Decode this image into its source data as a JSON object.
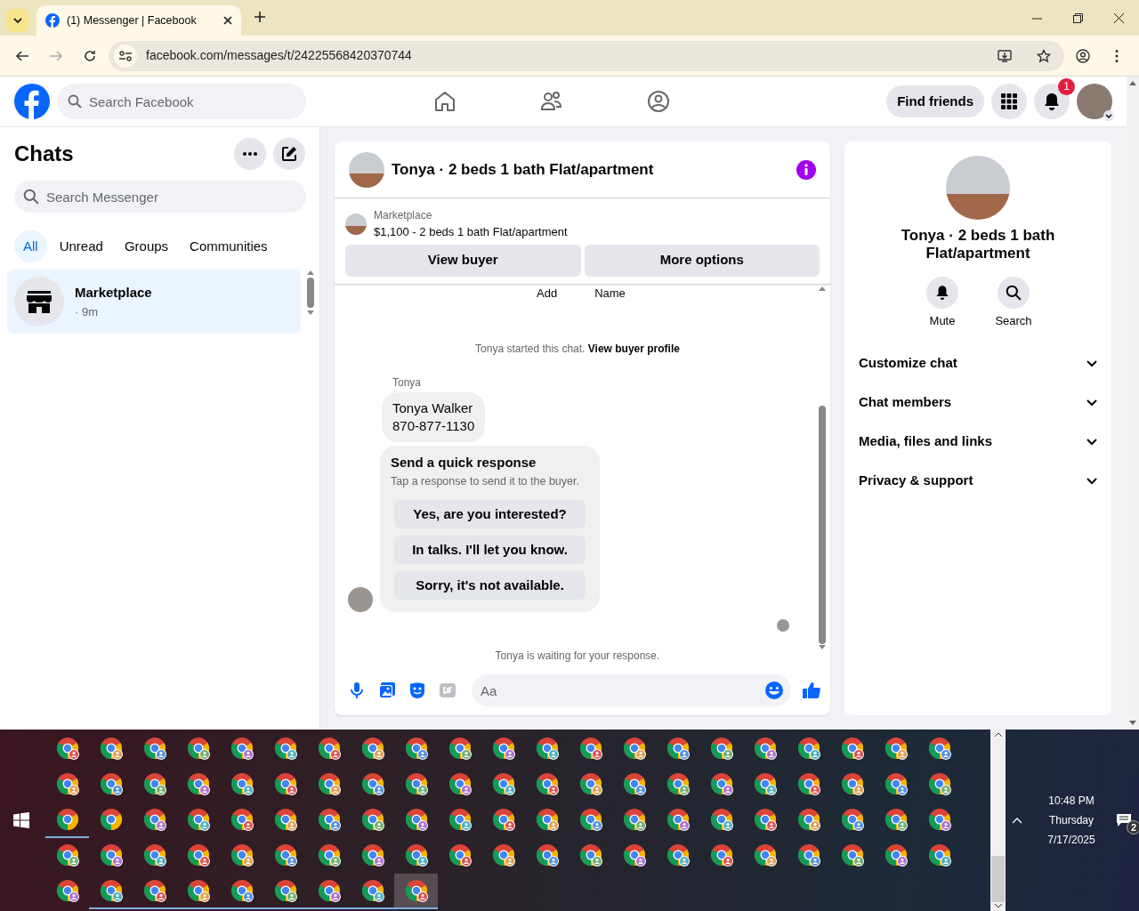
{
  "browser": {
    "tab_title": "(1) Messenger | Facebook",
    "url": "facebook.com/messages/t/24225568420370744"
  },
  "topbar": {
    "search_placeholder": "Search Facebook",
    "find_friends": "Find friends",
    "notification_count": "1"
  },
  "sidebar": {
    "title": "Chats",
    "search_placeholder": "Search Messenger",
    "filters": [
      {
        "label": "All",
        "selected": true
      },
      {
        "label": "Unread",
        "selected": false
      },
      {
        "label": "Groups",
        "selected": false
      },
      {
        "label": "Communities",
        "selected": false
      }
    ],
    "chats": [
      {
        "name": "Marketplace",
        "time": "· 9m",
        "selected": true
      }
    ]
  },
  "chat": {
    "title": "Tonya · 2 beds 1 bath Flat/apartment",
    "listing_source": "Marketplace",
    "listing_summary": "$1,100 - 2 beds 1 bath Flat/apartment",
    "buttons": [
      "View buyer",
      "More options"
    ],
    "cut_off_labels": [
      "Add",
      "Name"
    ],
    "system_note": "Tonya started this chat.",
    "system_link": "View buyer profile",
    "sender": "Tonya",
    "message_lines": [
      "Tonya Walker",
      "870-877-1130"
    ],
    "quick_response": {
      "title": "Send a quick response",
      "subtitle": "Tap a response to send it to the buyer.",
      "options": [
        "Yes, are you interested?",
        "In talks. I'll let you know.",
        "Sorry, it's not available."
      ]
    },
    "waiting_note": "Tonya is waiting for your response.",
    "composer_placeholder": "Aa"
  },
  "details": {
    "title": "Tonya · 2 beds 1 bath Flat/apartment",
    "actions": [
      "Mute",
      "Search"
    ],
    "sections": [
      "Customize chat",
      "Chat members",
      "Media, files and links",
      "Privacy & support"
    ]
  },
  "taskbar": {
    "time": "10:48 PM",
    "day": "Thursday",
    "date": "7/17/2025",
    "notification_count": "2",
    "rows": [
      [
        {
          "badge": true,
          "running": false,
          "selected": false
        },
        {
          "badge": true,
          "running": false,
          "selected": false
        },
        {
          "badge": true,
          "running": false,
          "selected": false
        },
        {
          "badge": true,
          "running": false,
          "selected": false
        },
        {
          "badge": true,
          "running": false,
          "selected": false
        },
        {
          "badge": true,
          "running": false,
          "selected": false
        },
        {
          "badge": true,
          "running": false,
          "selected": false
        },
        {
          "badge": true,
          "running": false,
          "selected": false
        },
        {
          "badge": true,
          "running": false,
          "selected": false
        },
        {
          "badge": true,
          "running": false,
          "selected": false
        },
        {
          "badge": true,
          "running": false,
          "selected": false
        },
        {
          "badge": true,
          "running": false,
          "selected": false
        },
        {
          "badge": true,
          "running": false,
          "selected": false
        },
        {
          "badge": true,
          "running": false,
          "selected": false
        },
        {
          "badge": true,
          "running": false,
          "selected": false
        },
        {
          "badge": true,
          "running": false,
          "selected": false
        },
        {
          "badge": true,
          "running": false,
          "selected": false
        },
        {
          "badge": true,
          "running": false,
          "selected": false
        },
        {
          "badge": true,
          "running": false,
          "selected": false
        },
        {
          "badge": true,
          "running": false,
          "selected": false
        },
        {
          "badge": true,
          "running": false,
          "selected": false
        }
      ],
      [
        {
          "badge": true,
          "running": false,
          "selected": false
        },
        {
          "badge": true,
          "running": false,
          "selected": false
        },
        {
          "badge": true,
          "running": false,
          "selected": false
        },
        {
          "badge": true,
          "running": false,
          "selected": false
        },
        {
          "badge": true,
          "running": false,
          "selected": false
        },
        {
          "badge": true,
          "running": false,
          "selected": false
        },
        {
          "badge": true,
          "running": false,
          "selected": false
        },
        {
          "badge": true,
          "running": false,
          "selected": false
        },
        {
          "badge": true,
          "running": false,
          "selected": false
        },
        {
          "badge": true,
          "running": false,
          "selected": false
        },
        {
          "badge": true,
          "running": false,
          "selected": false
        },
        {
          "badge": true,
          "running": false,
          "selected": false
        },
        {
          "badge": true,
          "running": false,
          "selected": false
        },
        {
          "badge": true,
          "running": false,
          "selected": false
        },
        {
          "badge": true,
          "running": false,
          "selected": false
        },
        {
          "badge": true,
          "running": false,
          "selected": false
        },
        {
          "badge": true,
          "running": false,
          "selected": false
        },
        {
          "badge": true,
          "running": false,
          "selected": false
        },
        {
          "badge": true,
          "running": false,
          "selected": false
        },
        {
          "badge": true,
          "running": false,
          "selected": false
        },
        {
          "badge": true,
          "running": false,
          "selected": false
        }
      ],
      [
        {
          "badge": false,
          "running": true,
          "selected": false
        },
        {
          "badge": false,
          "running": false,
          "selected": false
        },
        {
          "badge": true,
          "running": false,
          "selected": false
        },
        {
          "badge": true,
          "running": false,
          "selected": false
        },
        {
          "badge": true,
          "running": false,
          "selected": false
        },
        {
          "badge": true,
          "running": false,
          "selected": false
        },
        {
          "badge": true,
          "running": false,
          "selected": false
        },
        {
          "badge": true,
          "running": false,
          "selected": false
        },
        {
          "badge": true,
          "running": false,
          "selected": false
        },
        {
          "badge": true,
          "running": false,
          "selected": false
        },
        {
          "badge": true,
          "running": false,
          "selected": false
        },
        {
          "badge": true,
          "running": false,
          "selected": false
        },
        {
          "badge": true,
          "running": false,
          "selected": false
        },
        {
          "badge": true,
          "running": false,
          "selected": false
        },
        {
          "badge": true,
          "running": false,
          "selected": false
        },
        {
          "badge": true,
          "running": false,
          "selected": false
        },
        {
          "badge": true,
          "running": false,
          "selected": false
        },
        {
          "badge": true,
          "running": false,
          "selected": false
        },
        {
          "badge": true,
          "running": false,
          "selected": false
        },
        {
          "badge": true,
          "running": false,
          "selected": false
        },
        {
          "badge": true,
          "running": false,
          "selected": false
        }
      ],
      [
        {
          "badge": true,
          "running": false,
          "selected": false
        },
        {
          "badge": true,
          "running": false,
          "selected": false
        },
        {
          "badge": true,
          "running": false,
          "selected": false
        },
        {
          "badge": true,
          "running": false,
          "selected": false
        },
        {
          "badge": true,
          "running": false,
          "selected": false
        },
        {
          "badge": true,
          "running": false,
          "selected": false
        },
        {
          "badge": true,
          "running": false,
          "selected": false
        },
        {
          "badge": true,
          "running": false,
          "selected": false
        },
        {
          "badge": true,
          "running": false,
          "selected": false
        },
        {
          "badge": true,
          "running": false,
          "selected": false
        },
        {
          "badge": true,
          "running": false,
          "selected": false
        },
        {
          "badge": true,
          "running": false,
          "selected": false
        },
        {
          "badge": true,
          "running": false,
          "selected": false
        },
        {
          "badge": true,
          "running": false,
          "selected": false
        },
        {
          "badge": true,
          "running": false,
          "selected": false
        },
        {
          "badge": true,
          "running": false,
          "selected": false
        },
        {
          "badge": true,
          "running": false,
          "selected": false
        },
        {
          "badge": true,
          "running": false,
          "selected": false
        },
        {
          "badge": true,
          "running": false,
          "selected": false
        },
        {
          "badge": true,
          "running": false,
          "selected": false
        },
        {
          "badge": true,
          "running": false,
          "selected": false
        }
      ],
      [
        {
          "badge": true,
          "running": false,
          "selected": false
        },
        {
          "badge": true,
          "running": true,
          "selected": false
        },
        {
          "badge": true,
          "running": true,
          "selected": false
        },
        {
          "badge": true,
          "running": true,
          "selected": false
        },
        {
          "badge": true,
          "running": true,
          "selected": false
        },
        {
          "badge": true,
          "running": true,
          "selected": false
        },
        {
          "badge": true,
          "running": true,
          "selected": false
        },
        {
          "badge": true,
          "running": true,
          "selected": false
        },
        {
          "badge": true,
          "running": true,
          "selected": true
        }
      ]
    ]
  }
}
